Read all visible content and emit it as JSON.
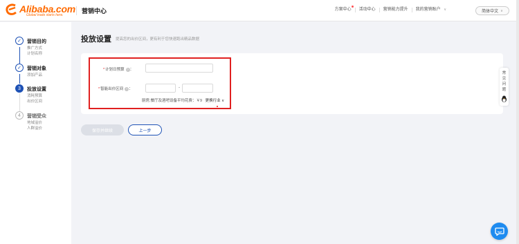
{
  "header": {
    "logo_text": "Alibaba.com",
    "logo_tagline": "Global trade starts here.",
    "app_title": "营销中心",
    "nav": [
      {
        "label": "方案中心",
        "badge": true
      },
      {
        "label": "活动中心"
      },
      {
        "label": "营销能力提升"
      },
      {
        "label": "我的营销账户",
        "dropdown": true
      }
    ],
    "language": "简体中文"
  },
  "steps": [
    {
      "title": "营销目的",
      "subs": [
        "推广方式",
        "计划名称"
      ],
      "status": "done"
    },
    {
      "title": "营销对象",
      "subs": [
        "添加产品"
      ],
      "status": "done"
    },
    {
      "title": "投放设置",
      "subs": [
        "消耗预算",
        "出价区间"
      ],
      "status": "active",
      "number": "3"
    },
    {
      "title": "营销受众",
      "subs": [
        "地域溢价",
        "人群溢价"
      ],
      "status": "pending",
      "number": "4"
    }
  ],
  "main": {
    "title": "投放设置",
    "description": "提高您的出价区间，更有利于您快速跑出精品数据",
    "fields": {
      "daily_budget_label": "计划日预算",
      "bid_range_label": "智能出价区间",
      "range_separator": "-",
      "hint_text": "厨房,餐厅及酒吧设备平均花费：￥9",
      "hint_link": "更换行业"
    },
    "buttons": {
      "primary": "保存并继续",
      "back": "上一步"
    }
  },
  "float_panel": {
    "text": "常见问题"
  },
  "colors": {
    "brand_orange": "#ff6a00",
    "primary_blue": "#1d51b5",
    "highlight_red": "#e02020",
    "chat_blue": "#1e8bf0"
  }
}
